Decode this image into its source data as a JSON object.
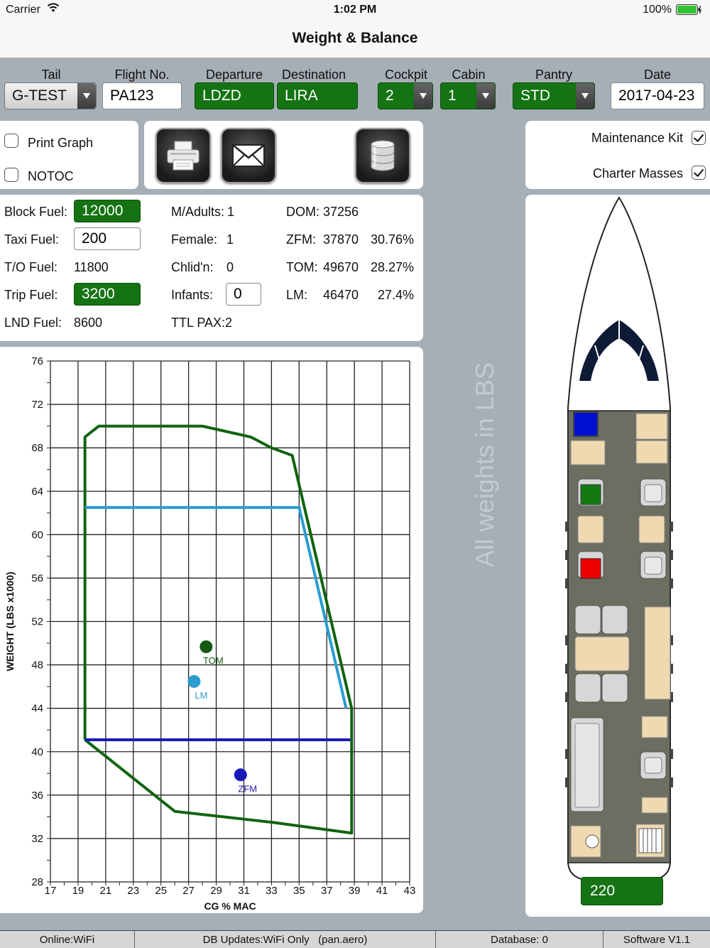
{
  "status": {
    "carrier": "Carrier",
    "time": "1:02 PM",
    "battery": "100%"
  },
  "nav": {
    "title": "Weight & Balance"
  },
  "top": {
    "tail_label": "Tail",
    "tail_value": "G-TEST",
    "flight_label": "Flight No.",
    "flight_value": "PA123",
    "departure_label": "Departure",
    "departure_value": "LDZD",
    "destination_label": "Destination",
    "destination_value": "LIRA",
    "cockpit_label": "Cockpit",
    "cockpit_value": "2",
    "cabin_label": "Cabin",
    "cabin_value": "1",
    "pantry_label": "Pantry",
    "pantry_value": "STD",
    "date_label": "Date",
    "date_value": "2017-04-23"
  },
  "options": {
    "print_graph": "Print Graph",
    "print_graph_checked": false,
    "notoc": "NOTOC",
    "notoc_checked": false
  },
  "actions": {
    "print_icon": "printer-icon",
    "email_icon": "envelope-icon",
    "database_icon": "database-icon"
  },
  "extras": {
    "maintenance_kit": "Maintenance Kit",
    "maintenance_kit_checked": true,
    "charter_masses": "Charter Masses",
    "charter_masses_checked": true
  },
  "fuel": {
    "block_label": "Block Fuel:",
    "block_value": "12000",
    "taxi_label": "Taxi Fuel:",
    "taxi_value": "200",
    "to_label": "T/O Fuel:",
    "to_value": "11800",
    "trip_label": "Trip Fuel:",
    "trip_value": "3200",
    "lnd_label": "LND Fuel:",
    "lnd_value": "8600"
  },
  "pax": {
    "adults_label": "M/Adults:",
    "adults_value": "1",
    "female_label": "Female:",
    "female_value": "1",
    "children_label": "Chlid'n:",
    "children_value": "0",
    "infants_label": "Infants:",
    "infants_value": "0",
    "total_label": "TTL PAX:",
    "total_value": "2"
  },
  "masses": {
    "dom_label": "DOM:",
    "dom_value": "37256",
    "zfm_label": "ZFM:",
    "zfm_value": "37870",
    "zfm_pct": "30.76%",
    "tom_label": "TOM:",
    "tom_value": "49670",
    "tom_pct": "28.27%",
    "lm_label": "LM:",
    "lm_value": "46470",
    "lm_pct": "27.4%"
  },
  "watermark": "All weights in LBS",
  "cabin_total": "220",
  "seat_colors": {
    "blue": "#0010d0",
    "green": "#137a13",
    "red": "#ee0000"
  },
  "bottom": {
    "online": "Online:WiFi",
    "db_updates": "DB Updates:WiFi Only",
    "site": "(pan.aero)",
    "database": "Database: 0",
    "software": "Software V1.1"
  },
  "chart_data": {
    "type": "scatter",
    "xlabel": "CG % MAC",
    "ylabel": "WEIGHT (LBS x1000)",
    "xlim": [
      17,
      43
    ],
    "ylim": [
      28,
      76
    ],
    "x_ticks": [
      17,
      19,
      21,
      23,
      25,
      27,
      29,
      31,
      33,
      35,
      37,
      39,
      41,
      43
    ],
    "y_ticks": [
      28,
      32,
      36,
      40,
      44,
      48,
      52,
      56,
      60,
      64,
      68,
      72,
      76
    ],
    "grid": true,
    "envelope": [
      [
        19.5,
        41.1
      ],
      [
        19.5,
        69
      ],
      [
        20.5,
        70
      ],
      [
        21.5,
        70
      ],
      [
        28,
        70
      ],
      [
        31.5,
        69
      ],
      [
        33,
        68
      ],
      [
        34.5,
        67.3
      ],
      [
        38.8,
        44
      ],
      [
        38.8,
        32.5
      ],
      [
        33,
        33.5
      ],
      [
        26,
        34.5
      ],
      [
        19.5,
        41.1
      ]
    ],
    "lines": [
      {
        "name": "max-landing",
        "points": [
          [
            19.5,
            62.5
          ],
          [
            35,
            62.5
          ],
          [
            38.4,
            44
          ]
        ],
        "color": "#2b9cd1"
      },
      {
        "name": "max-zero-fuel",
        "points": [
          [
            19.5,
            41.1
          ],
          [
            38.7,
            41.1
          ]
        ],
        "color": "#1a1ab8"
      }
    ],
    "points": [
      {
        "label": "TOM",
        "x": 28.27,
        "y": 49.67,
        "color": "#145a14"
      },
      {
        "label": "LM",
        "x": 27.4,
        "y": 46.47,
        "color": "#2b9cd1"
      },
      {
        "label": "ZFM",
        "x": 30.76,
        "y": 37.87,
        "color": "#1a1ab8"
      }
    ]
  }
}
